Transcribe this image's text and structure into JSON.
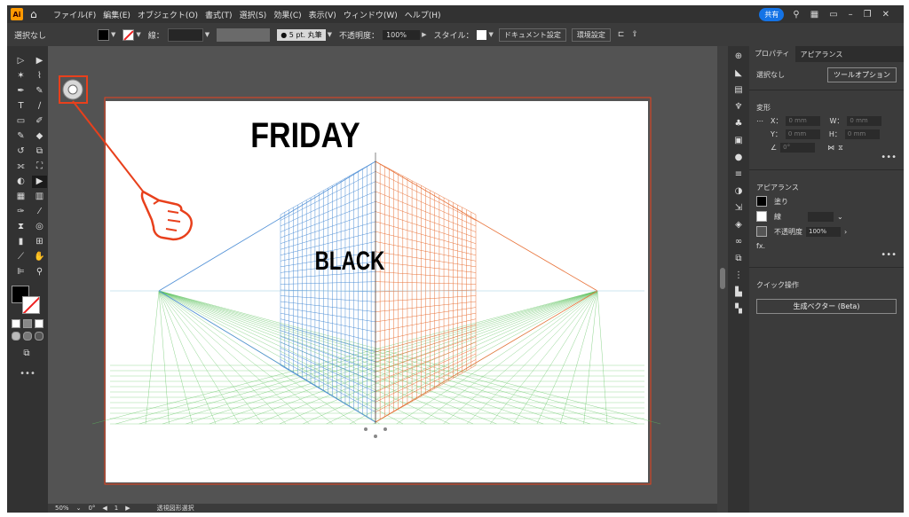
{
  "menubar": {
    "logo": "Ai",
    "items": [
      "ファイル(F)",
      "編集(E)",
      "オブジェクト(O)",
      "書式(T)",
      "選択(S)",
      "効果(C)",
      "表示(V)",
      "ウィンドウ(W)",
      "ヘルプ(H)"
    ],
    "share_label": "共有"
  },
  "controlbar": {
    "selection_label": "選択なし",
    "stroke_label": "線：",
    "brush_label": "● 5 pt. 丸筆",
    "opacity_label": "不透明度：",
    "opacity_value": "100%",
    "style_label": "スタイル：",
    "doc_settings_label": "ドキュメント設定",
    "prefs_label": "環境設定"
  },
  "artboard": {
    "title": "FRIDAY",
    "subtitle": "BLACK"
  },
  "statusbar": {
    "zoom": "50%",
    "rotation": "0°",
    "artboard_num": "1",
    "status_text": "透視図形選択"
  },
  "panel": {
    "tabs": [
      "プロパティ",
      "アピアランス"
    ],
    "no_selection": "選択なし",
    "tool_options_label": "ツールオプション",
    "transform_title": "変形",
    "x_label": "X：",
    "y_label": "Y：",
    "w_label": "W：",
    "h_label": "H：",
    "x_value": "0 mm",
    "y_value": "0 mm",
    "w_value": "0 mm",
    "h_value": "0 mm",
    "rotate_value": "0°",
    "appearance_title": "アピアランス",
    "fill_label": "塗り",
    "stroke_label": "線",
    "opacity_label": "不透明度",
    "opacity_value": "100%",
    "fx_label": "fx.",
    "quick_actions_title": "クイック操作",
    "generate_vector_label": "生成ベクター (Beta)"
  },
  "colors": {
    "grid_left": "#4f8fd6",
    "grid_right": "#e8733a",
    "grid_ground": "#5cc25c",
    "annotation": "#e8401c"
  }
}
